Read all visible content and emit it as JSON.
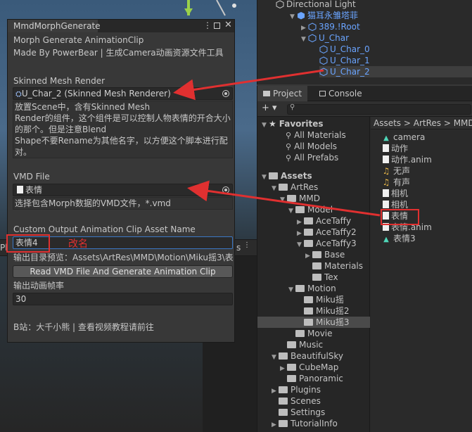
{
  "hierarchy": {
    "items": [
      {
        "label": "Directional Light",
        "indent": 1
      },
      {
        "label": "猫耳永雏塔菲",
        "indent": 1
      },
      {
        "label": "389.!Root",
        "indent": 2
      },
      {
        "label": "U_Char",
        "indent": 2
      },
      {
        "label": "U_Char_0",
        "indent": 3
      },
      {
        "label": "U_Char_1",
        "indent": 3
      },
      {
        "label": "U_Char_2",
        "indent": 3
      }
    ]
  },
  "project": {
    "tabs": {
      "project": "Project",
      "console": "Console"
    },
    "add_button": "+ ▾",
    "search_placeholder": "",
    "tree": [
      {
        "label": "Favorites",
        "type": "star"
      },
      {
        "label": "All Materials",
        "type": "search"
      },
      {
        "label": "All Models",
        "type": "search"
      },
      {
        "label": "All Prefabs",
        "type": "search"
      },
      {
        "label": "Assets",
        "type": "folder"
      },
      {
        "label": "ArtRes",
        "type": "folder"
      },
      {
        "label": "MMD",
        "type": "folder"
      },
      {
        "label": "Model",
        "type": "folder"
      },
      {
        "label": "AceTaffy",
        "type": "folder"
      },
      {
        "label": "AceTaffy2",
        "type": "folder"
      },
      {
        "label": "AceTaffy3",
        "type": "folder"
      },
      {
        "label": "Base",
        "type": "folder"
      },
      {
        "label": "Materials",
        "type": "folder"
      },
      {
        "label": "Tex",
        "type": "folder"
      },
      {
        "label": "Motion",
        "type": "folder"
      },
      {
        "label": "Miku摇",
        "type": "folder"
      },
      {
        "label": "Miku摇2",
        "type": "folder"
      },
      {
        "label": "Miku摇3",
        "type": "folder"
      },
      {
        "label": "Movie",
        "type": "folder"
      },
      {
        "label": "Music",
        "type": "folder"
      },
      {
        "label": "BeautifulSky",
        "type": "folder"
      },
      {
        "label": "CubeMap",
        "type": "folder"
      },
      {
        "label": "Panoramic",
        "type": "folder"
      },
      {
        "label": "Plugins",
        "type": "folder"
      },
      {
        "label": "Scenes",
        "type": "folder"
      },
      {
        "label": "Settings",
        "type": "folder"
      },
      {
        "label": "TutorialInfo",
        "type": "folder"
      }
    ],
    "breadcrumb": "Assets > ArtRes > MMD",
    "assets": [
      {
        "label": "camera",
        "icon": "anim-clip"
      },
      {
        "label": "动作",
        "icon": "file"
      },
      {
        "label": "动作.anim",
        "icon": "file"
      },
      {
        "label": "无声",
        "icon": "audio"
      },
      {
        "label": "有声",
        "icon": "audio"
      },
      {
        "label": "相机",
        "icon": "file"
      },
      {
        "label": "相机",
        "icon": "file"
      },
      {
        "label": "表情",
        "icon": "file"
      },
      {
        "label": "表情.anim",
        "icon": "file"
      },
      {
        "label": "表情3",
        "icon": "anim-clip"
      }
    ]
  },
  "mmd_window": {
    "tab_title": "MmdMorphGenerate",
    "title": "Morph Generate AnimationClip",
    "made_by": "Made By PowerBear | 生成Camera动画资源文件工具",
    "skinned_label": "Skinned Mesh Render",
    "skinned_value": "U_Char_2 (Skinned Mesh Renderer)",
    "skinned_help": [
      "放置Scene中，含有Skinned Mesh",
      "Render的组件，这个组件是可以控制人物表情的开合大小",
      "的那个。但是注意Blend",
      "Shape不要Rename为其他名字，以方便这个脚本进行配",
      "对。"
    ],
    "vmd_label": "VMD File",
    "vmd_value": "表情",
    "vmd_help": "选择包含Morph数据的VMD文件，*.vmd",
    "output_label": "Custom Output Animation Clip Asset Name",
    "output_value": "表情4",
    "output_preview": "输出目录预览：Assets\\ArtRes\\MMD\\Motion\\Miku摇3\\表",
    "generate_button": "Read VMD File And Generate Animation Clip",
    "fps_label": "输出动画帧率",
    "fps_value": "30",
    "footer": "B站：大千小熊 | 查看视频教程请前往",
    "annotation": "改名"
  },
  "scene_strip": {
    "left": "Pla",
    "right": "s"
  },
  "colors": {
    "accent_blue": "#6aa4ff",
    "annotation_red": "#e03030"
  }
}
